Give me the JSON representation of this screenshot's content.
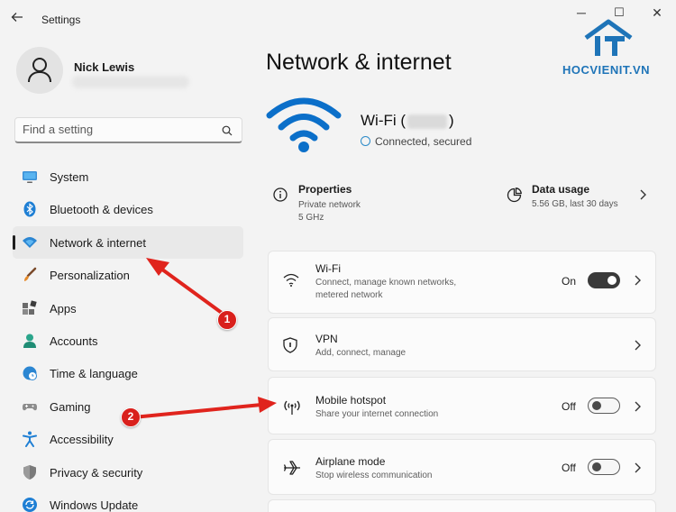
{
  "window": {
    "title": "Settings",
    "back_icon": "back-arrow-icon",
    "controls": {
      "minimize": "─",
      "maximize": "☐",
      "close": "✕"
    }
  },
  "user": {
    "name": "Nick Lewis"
  },
  "search": {
    "placeholder": "Find a setting"
  },
  "sidebar": {
    "items": [
      {
        "label": "System",
        "icon": "monitor-icon"
      },
      {
        "label": "Bluetooth & devices",
        "icon": "bluetooth-icon"
      },
      {
        "label": "Network & internet",
        "icon": "wifi-icon",
        "active": true
      },
      {
        "label": "Personalization",
        "icon": "brush-icon"
      },
      {
        "label": "Apps",
        "icon": "apps-icon"
      },
      {
        "label": "Accounts",
        "icon": "person-icon"
      },
      {
        "label": "Time & language",
        "icon": "clock-globe-icon"
      },
      {
        "label": "Gaming",
        "icon": "gamepad-icon"
      },
      {
        "label": "Accessibility",
        "icon": "accessibility-icon"
      },
      {
        "label": "Privacy & security",
        "icon": "shield-icon"
      },
      {
        "label": "Windows Update",
        "icon": "update-icon"
      }
    ]
  },
  "main": {
    "title": "Network & internet",
    "wifi": {
      "name_prefix": "Wi-Fi (",
      "name_suffix": ")",
      "status": "Connected, secured"
    },
    "properties": {
      "title": "Properties",
      "line1": "Private network",
      "line2": "5 GHz"
    },
    "data_usage": {
      "title": "Data usage",
      "subtitle": "5.56 GB, last 30 days"
    },
    "cards": [
      {
        "title": "Wi-Fi",
        "subtitle_line1": "Connect, manage known networks,",
        "subtitle_line2": "metered network",
        "state": "On",
        "toggle": true,
        "icon": "wifi-icon"
      },
      {
        "title": "VPN",
        "subtitle_line1": "Add, connect, manage",
        "icon": "vpn-shield-icon"
      },
      {
        "title": "Mobile hotspot",
        "subtitle_line1": "Share your internet connection",
        "state": "Off",
        "toggle": false,
        "icon": "hotspot-icon"
      },
      {
        "title": "Airplane mode",
        "subtitle_line1": "Stop wireless communication",
        "state": "Off",
        "toggle": false,
        "icon": "airplane-icon"
      }
    ]
  },
  "annotations": {
    "badge1": "1",
    "badge2": "2",
    "arrow_color": "#e0241d"
  },
  "watermark": {
    "text": "HOCVIENIT.VN",
    "color": "#1e74b8"
  },
  "colors": {
    "accent": "#0067c0",
    "background": "#f3f3f3"
  }
}
